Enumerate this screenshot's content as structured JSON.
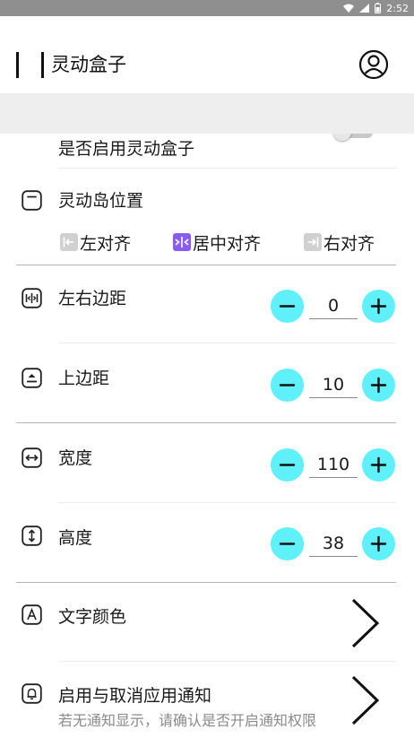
{
  "status_bar": {
    "time": "2:52",
    "icons": [
      "wifi-icon",
      "signal-icon",
      "battery-icon"
    ]
  },
  "app_bar": {
    "title": "灵动盒子",
    "profile_icon": "person-circle-icon"
  },
  "settings": {
    "enable": {
      "label": "是否启用灵动盒子",
      "toggled": false
    },
    "position": {
      "label": "灵动岛位置",
      "options": [
        {
          "label": "左对齐",
          "selected": false
        },
        {
          "label": "居中对齐",
          "selected": true
        },
        {
          "label": "右对齐",
          "selected": false
        }
      ]
    },
    "margin_lr": {
      "label": "左右边距",
      "value": "0"
    },
    "margin_top": {
      "label": "上边距",
      "value": "10"
    },
    "width": {
      "label": "宽度",
      "value": "110"
    },
    "height": {
      "label": "高度",
      "value": "38"
    },
    "text_color": {
      "label": "文字颜色"
    },
    "notification": {
      "label": "启用与取消应用通知",
      "sub_label": "若无通知显示，请确认是否开启通知权限"
    }
  },
  "colors": {
    "stepper_accent": "#5ff0fa",
    "selected_accent": "#8a5cf6",
    "unselected_gray": "#c8c8c8",
    "banner_bg": "#eeeeee"
  }
}
